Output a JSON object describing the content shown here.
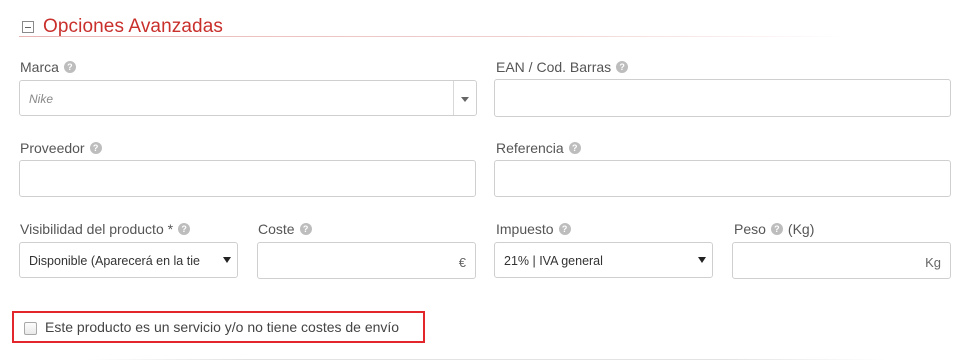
{
  "section": {
    "title": "Opciones Avanzadas"
  },
  "fields": {
    "marca": {
      "label": "Marca",
      "placeholder": "Nike"
    },
    "ean": {
      "label": "EAN / Cod. Barras",
      "value": ""
    },
    "proveedor": {
      "label": "Proveedor",
      "value": ""
    },
    "referencia": {
      "label": "Referencia",
      "value": ""
    },
    "visibilidad": {
      "label": "Visibilidad del producto *",
      "selected": "Disponible (Aparecerá en la tie"
    },
    "coste": {
      "label": "Coste",
      "value": "",
      "suffix": "€"
    },
    "impuesto": {
      "label": "Impuesto",
      "selected": "21% | IVA general"
    },
    "peso": {
      "label_prefix": "Peso",
      "label_suffix": "(Kg)",
      "value": "",
      "suffix": "Kg"
    }
  },
  "service_checkbox": {
    "label": "Este producto es un servicio y/o no tiene costes de envío",
    "checked": false
  },
  "help_glyph": "?",
  "icons": [
    "collapse-minus-icon",
    "help-icon",
    "chevron-down-icon"
  ],
  "colors": {
    "accent": "#c9302c",
    "highlight_border": "#e3262b"
  }
}
